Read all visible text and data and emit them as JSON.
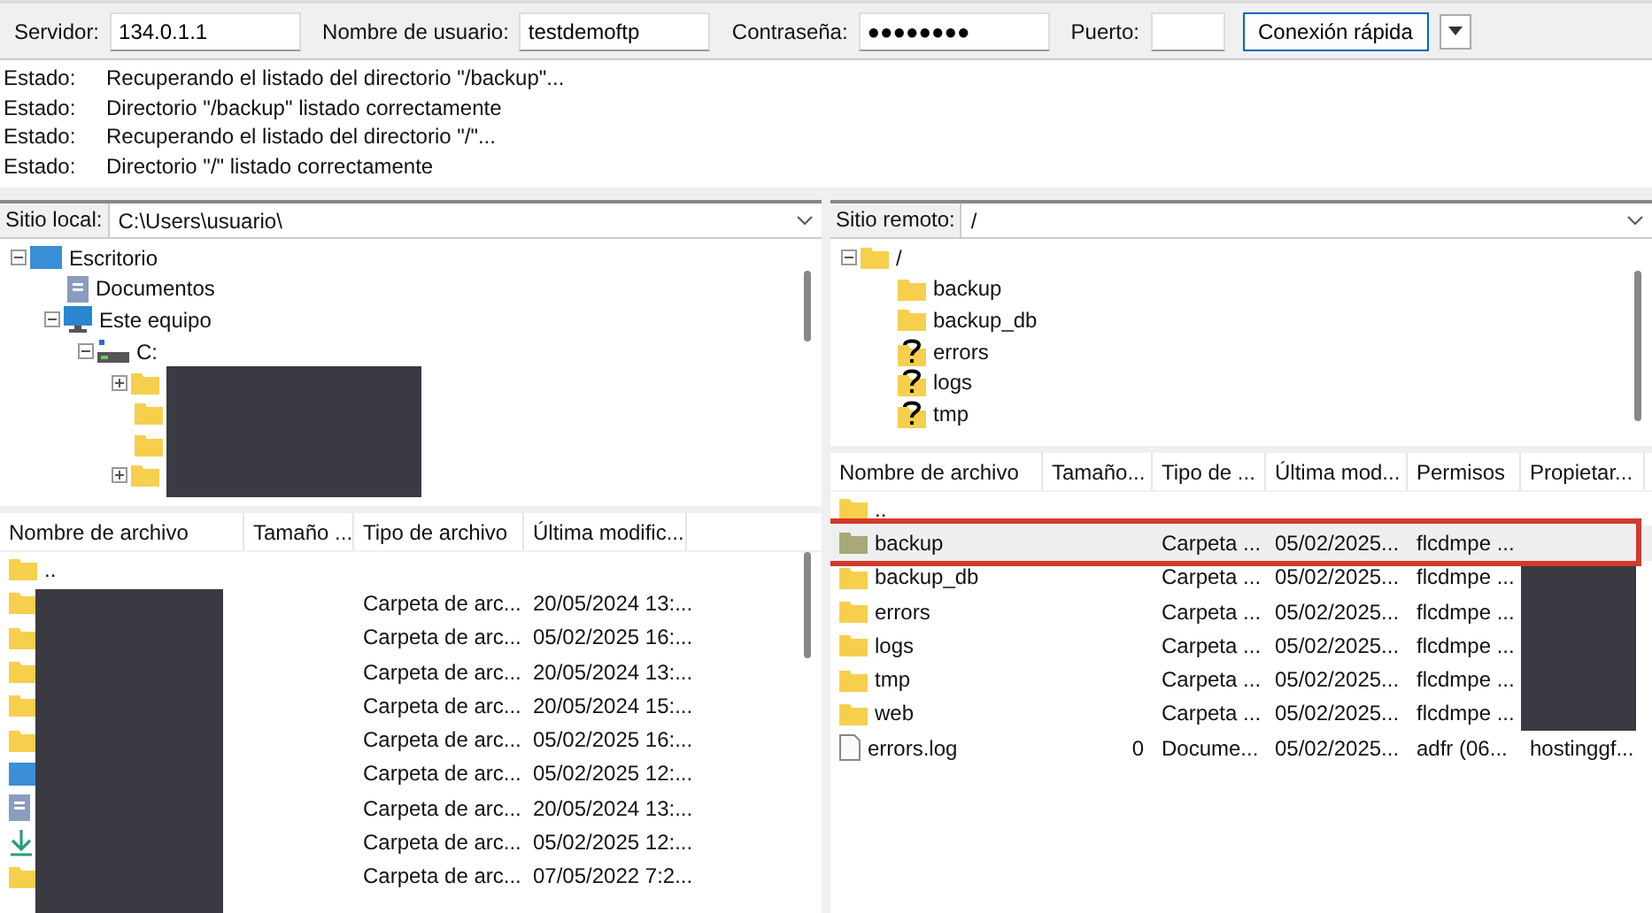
{
  "quickconnect": {
    "fields": [
      {
        "label": "Servidor:",
        "value": "134.0.1.1"
      },
      {
        "label": "Nombre de usuario:",
        "value": "testdemoftp"
      },
      {
        "label": "Contraseña:",
        "value": "●●●●●●●●"
      },
      {
        "label": "Puerto:"
      }
    ],
    "button": "Conexión rápida"
  },
  "log": [
    {
      "label": "Estado:",
      "message": "Recuperando el listado del directorio \"/backup\"..."
    },
    {
      "label": "Estado:",
      "message": "Directorio \"/backup\" listado correctamente"
    },
    {
      "label": "Estado:",
      "message": "Recuperando el listado del directorio \"/\"..."
    },
    {
      "label": "Estado:",
      "message": "Directorio \"/\" listado correctamente"
    }
  ],
  "local": {
    "site_label": "Sitio local:",
    "path": "C:\\Users\\usuario\\",
    "tree": [
      {
        "name": "Escritorio",
        "kind": "desktop",
        "expanded": true,
        "children": [
          {
            "name": "Documentos",
            "kind": "document"
          },
          {
            "name": "Este equipo",
            "kind": "computer",
            "expanded": true,
            "children": [
              {
                "name": "C:",
                "kind": "drive",
                "expanded": true,
                "children": [
                  {
                    "kind": "folder",
                    "expanded": false
                  },
                  {
                    "kind": "folder"
                  },
                  {
                    "kind": "folder"
                  },
                  {
                    "kind": "folder",
                    "expanded": false
                  }
                ]
              }
            ]
          }
        ]
      }
    ],
    "columns": [
      "Nombre de archivo",
      "Tamaño ...",
      "Tipo de archivo",
      "Última modific..."
    ],
    "rows": [
      {
        "kind": "folder",
        "name": ".."
      },
      {
        "kind": "folder",
        "type": "Carpeta de arc...",
        "modified": "20/05/2024 13:..."
      },
      {
        "kind": "folder",
        "type": "Carpeta de arc...",
        "modified": "05/02/2025 16:..."
      },
      {
        "kind": "folder",
        "type": "Carpeta de arc...",
        "modified": "20/05/2024 13:..."
      },
      {
        "kind": "folder",
        "type": "Carpeta de arc...",
        "modified": "20/05/2024 15:..."
      },
      {
        "kind": "folder",
        "type": "Carpeta de arc...",
        "modified": "05/02/2025 16:..."
      },
      {
        "kind": "desktop",
        "type": "Carpeta de arc...",
        "modified": "05/02/2025 12:..."
      },
      {
        "kind": "document",
        "type": "Carpeta de arc...",
        "modified": "20/05/2024 13:..."
      },
      {
        "kind": "download",
        "type": "Carpeta de arc...",
        "modified": "05/02/2025 12:..."
      },
      {
        "kind": "folder",
        "type": "Carpeta de arc...",
        "modified": "07/05/2022 7:2..."
      }
    ]
  },
  "remote": {
    "site_label": "Sitio remoto:",
    "path": "/",
    "tree": [
      {
        "name": "/",
        "kind": "folder",
        "expanded": true,
        "children": [
          {
            "name": "backup",
            "kind": "folder"
          },
          {
            "name": "backup_db",
            "kind": "folder"
          },
          {
            "name": "errors",
            "kind": "unknown"
          },
          {
            "name": "logs",
            "kind": "unknown"
          },
          {
            "name": "tmp",
            "kind": "unknown"
          }
        ]
      }
    ],
    "columns": [
      "Nombre de archivo",
      "Tamaño...",
      "Tipo de ...",
      "Última mod...",
      "Permisos",
      "Propietar..."
    ],
    "rows": [
      {
        "kind": "folder",
        "name": "..",
        "selected": false
      },
      {
        "kind": "folder",
        "name": "backup",
        "type": "Carpeta ...",
        "modified": "05/02/2025...",
        "permissions": "flcdmpe ...",
        "selected": true
      },
      {
        "kind": "folder",
        "name": "backup_db",
        "type": "Carpeta ...",
        "modified": "05/02/2025...",
        "permissions": "flcdmpe ...",
        "selected": false,
        "redacted": true
      },
      {
        "kind": "folder",
        "name": "errors",
        "type": "Carpeta ...",
        "modified": "05/02/2025...",
        "permissions": "flcdmpe ...",
        "selected": false,
        "redacted": true
      },
      {
        "kind": "folder",
        "name": "logs",
        "type": "Carpeta ...",
        "modified": "05/02/2025...",
        "permissions": "flcdmpe ...",
        "selected": false,
        "redacted": true
      },
      {
        "kind": "folder",
        "name": "tmp",
        "type": "Carpeta ...",
        "modified": "05/02/2025...",
        "permissions": "flcdmpe ...",
        "selected": false,
        "redacted": true
      },
      {
        "kind": "folder",
        "name": "web",
        "type": "Carpeta ...",
        "modified": "05/02/2025...",
        "permissions": "flcdmpe ...",
        "selected": false,
        "redacted": true
      },
      {
        "kind": "file",
        "name": "errors.log",
        "size": "0",
        "type": "Docume...",
        "modified": "05/02/2025...",
        "permissions": "adfr (06...",
        "owner": "hostinggf...",
        "selected": false
      }
    ]
  }
}
